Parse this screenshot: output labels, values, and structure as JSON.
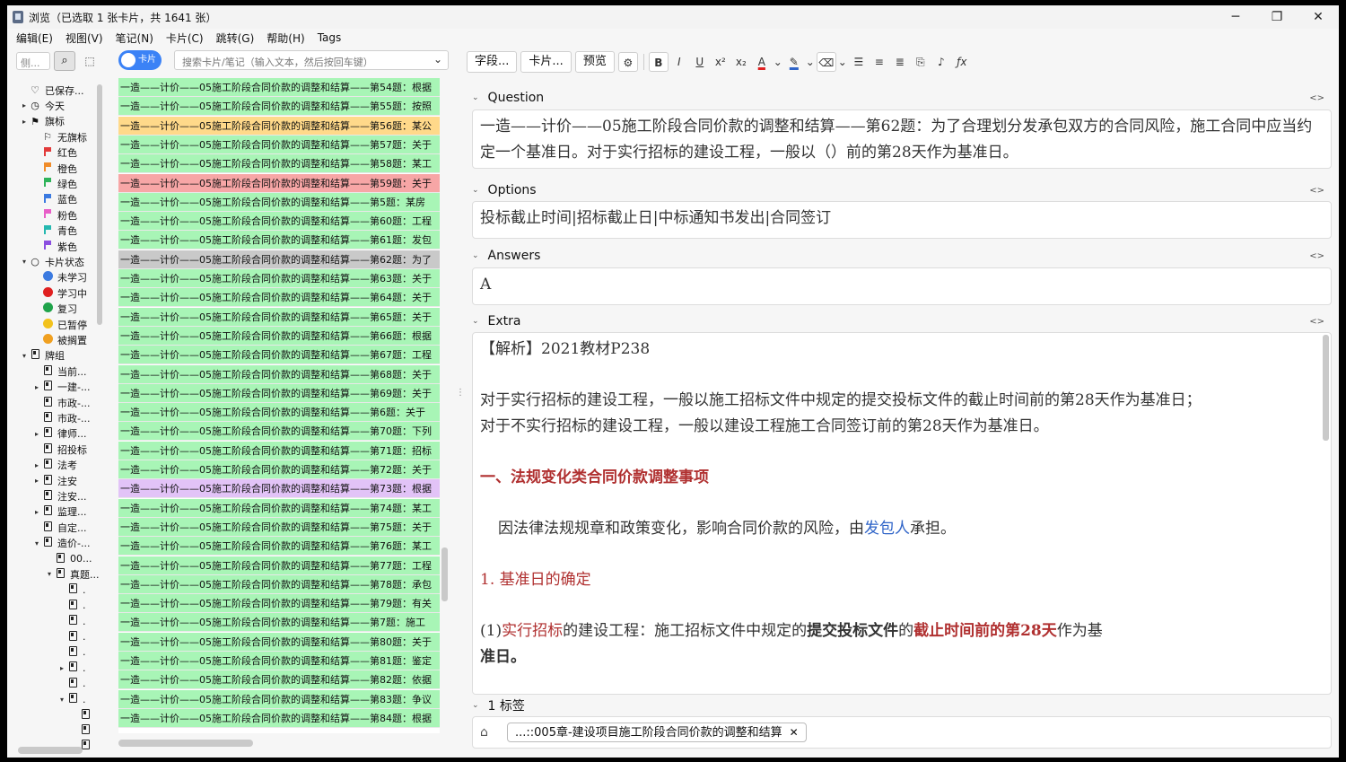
{
  "window": {
    "title": "浏览（已选取 1 张卡片，共 1641 张）",
    "minimize": "─",
    "maximize": "❐",
    "close": "✕"
  },
  "menu": [
    "编辑(E)",
    "视图(V)",
    "笔记(N)",
    "卡片(C)",
    "跳转(G)",
    "帮助(H)",
    "Tags"
  ],
  "sidebar": {
    "search_placeholder": "侧...",
    "items": [
      {
        "label": "已保存...",
        "icon": "heart-icon",
        "arrow": "",
        "indent": 1
      },
      {
        "label": "今天",
        "icon": "clock-icon",
        "arrow": "▸",
        "indent": 1
      },
      {
        "label": "旗标",
        "icon": "flag-icon",
        "arrow": "▸",
        "indent": 1
      },
      {
        "label": "无旗标",
        "icon": "no-flag-icon",
        "arrow": "",
        "indent": 2
      },
      {
        "label": "红色",
        "icon": "flag-red-icon",
        "color": "#e23b3b",
        "arrow": "",
        "indent": 2
      },
      {
        "label": "橙色",
        "icon": "flag-orange-icon",
        "color": "#f08c2a",
        "arrow": "",
        "indent": 2
      },
      {
        "label": "绿色",
        "icon": "flag-green-icon",
        "color": "#2fb35a",
        "arrow": "",
        "indent": 2
      },
      {
        "label": "蓝色",
        "icon": "flag-blue-icon",
        "color": "#3b7ae0",
        "arrow": "",
        "indent": 2
      },
      {
        "label": "粉色",
        "icon": "flag-pink-icon",
        "color": "#e85fc8",
        "arrow": "",
        "indent": 2
      },
      {
        "label": "青色",
        "icon": "flag-cyan-icon",
        "color": "#25b8b0",
        "arrow": "",
        "indent": 2
      },
      {
        "label": "紫色",
        "icon": "flag-purple-icon",
        "color": "#8b4fe0",
        "arrow": "",
        "indent": 2
      },
      {
        "label": "卡片状态",
        "icon": "circle-icon",
        "arrow": "▾",
        "indent": 1
      },
      {
        "label": "未学习",
        "icon": "dot-blue-icon",
        "color": "#3b7ae0",
        "arrow": "",
        "indent": 2
      },
      {
        "label": "学习中",
        "icon": "dot-red-icon",
        "color": "#e02020",
        "arrow": "",
        "indent": 2
      },
      {
        "label": "复习",
        "icon": "dot-green-icon",
        "color": "#1fa34a",
        "arrow": "",
        "indent": 2
      },
      {
        "label": "已暂停",
        "icon": "dot-yellow-icon",
        "color": "#f2c21c",
        "arrow": "",
        "indent": 2
      },
      {
        "label": "被搁置",
        "icon": "dot-orange-icon",
        "color": "#f0a020",
        "arrow": "",
        "indent": 2
      },
      {
        "label": "牌组",
        "icon": "deck-icon",
        "arrow": "▾",
        "indent": 1
      },
      {
        "label": "当前...",
        "icon": "deck-icon",
        "arrow": "",
        "indent": 2
      },
      {
        "label": "一建-...",
        "icon": "deck-icon",
        "arrow": "▸",
        "indent": 2
      },
      {
        "label": "市政-...",
        "icon": "deck-icon",
        "arrow": "",
        "indent": 2
      },
      {
        "label": "市政-...",
        "icon": "deck-icon",
        "arrow": "",
        "indent": 2
      },
      {
        "label": "律师...",
        "icon": "deck-icon",
        "arrow": "▸",
        "indent": 2
      },
      {
        "label": "招投标",
        "icon": "deck-icon",
        "arrow": "",
        "indent": 2
      },
      {
        "label": "法考",
        "icon": "deck-icon",
        "arrow": "▸",
        "indent": 2
      },
      {
        "label": "注安",
        "icon": "deck-icon",
        "arrow": "▸",
        "indent": 2
      },
      {
        "label": "注安...",
        "icon": "deck-icon",
        "arrow": "",
        "indent": 2
      },
      {
        "label": "监理...",
        "icon": "deck-icon",
        "arrow": "▸",
        "indent": 2
      },
      {
        "label": "自定...",
        "icon": "deck-icon",
        "arrow": "",
        "indent": 2
      },
      {
        "label": "造价-...",
        "icon": "deck-icon",
        "arrow": "▾",
        "indent": 2
      },
      {
        "label": "00...",
        "icon": "deck-icon",
        "arrow": "",
        "indent": 3
      },
      {
        "label": "真题...",
        "icon": "deck-icon",
        "arrow": "▾",
        "indent": 3
      },
      {
        "label": ".",
        "icon": "deck-icon",
        "arrow": "",
        "indent": 4
      },
      {
        "label": ".",
        "icon": "deck-icon",
        "arrow": "",
        "indent": 4
      },
      {
        "label": ".",
        "icon": "deck-icon",
        "arrow": "",
        "indent": 4
      },
      {
        "label": ".",
        "icon": "deck-icon",
        "arrow": "",
        "indent": 4
      },
      {
        "label": ".",
        "icon": "deck-icon",
        "arrow": "",
        "indent": 4
      },
      {
        "label": ".",
        "icon": "deck-icon",
        "arrow": "▸",
        "indent": 4
      },
      {
        "label": ".",
        "icon": "deck-icon",
        "arrow": "",
        "indent": 4
      },
      {
        "label": ".",
        "icon": "deck-icon",
        "arrow": "▾",
        "indent": 4
      },
      {
        "label": "",
        "icon": "deck-icon",
        "arrow": "",
        "indent": 5
      },
      {
        "label": "",
        "icon": "deck-icon",
        "arrow": "",
        "indent": 5
      },
      {
        "label": "",
        "icon": "deck-icon",
        "arrow": "",
        "indent": 5
      }
    ]
  },
  "browser": {
    "toggle_label": "卡片",
    "search_placeholder": "搜索卡片/笔记（输入文本，然后按回车键）",
    "rows": [
      {
        "text": "一造——计价——05施工阶段合同价款的调整和结算——第54题：根据",
        "color": "g"
      },
      {
        "text": "一造——计价——05施工阶段合同价款的调整和结算——第55题：按照",
        "color": "g"
      },
      {
        "text": "一造——计价——05施工阶段合同价款的调整和结算——第56题：某公",
        "color": "y"
      },
      {
        "text": "一造——计价——05施工阶段合同价款的调整和结算——第57题：关于",
        "color": "g"
      },
      {
        "text": "一造——计价——05施工阶段合同价款的调整和结算——第58题：某工",
        "color": "g"
      },
      {
        "text": "一造——计价——05施工阶段合同价款的调整和结算——第59题：关于",
        "color": "r"
      },
      {
        "text": "一造——计价——05施工阶段合同价款的调整和结算——第5题：某房",
        "color": "g"
      },
      {
        "text": "一造——计价——05施工阶段合同价款的调整和结算——第60题：工程",
        "color": "g"
      },
      {
        "text": "一造——计价——05施工阶段合同价款的调整和结算——第61题：发包",
        "color": "g"
      },
      {
        "text": "一造——计价——05施工阶段合同价款的调整和结算——第62题：为了",
        "color": "s"
      },
      {
        "text": "一造——计价——05施工阶段合同价款的调整和结算——第63题：关于",
        "color": "g"
      },
      {
        "text": "一造——计价——05施工阶段合同价款的调整和结算——第64题：关于",
        "color": "g"
      },
      {
        "text": "一造——计价——05施工阶段合同价款的调整和结算——第65题：关于",
        "color": "g"
      },
      {
        "text": "一造——计价——05施工阶段合同价款的调整和结算——第66题：根据",
        "color": "g"
      },
      {
        "text": "一造——计价——05施工阶段合同价款的调整和结算——第67题：工程",
        "color": "g"
      },
      {
        "text": "一造——计价——05施工阶段合同价款的调整和结算——第68题：关于",
        "color": "g"
      },
      {
        "text": "一造——计价——05施工阶段合同价款的调整和结算——第69题：关于",
        "color": "g"
      },
      {
        "text": "一造——计价——05施工阶段合同价款的调整和结算——第6题：关于",
        "color": "g"
      },
      {
        "text": "一造——计价——05施工阶段合同价款的调整和结算——第70题：下列",
        "color": "g"
      },
      {
        "text": "一造——计价——05施工阶段合同价款的调整和结算——第71题：招标",
        "color": "g"
      },
      {
        "text": "一造——计价——05施工阶段合同价款的调整和结算——第72题：关于",
        "color": "g"
      },
      {
        "text": "一造——计价——05施工阶段合同价款的调整和结算——第73题：根据",
        "color": "p"
      },
      {
        "text": "一造——计价——05施工阶段合同价款的调整和结算——第74题：某工",
        "color": "g"
      },
      {
        "text": "一造——计价——05施工阶段合同价款的调整和结算——第75题：关于",
        "color": "g"
      },
      {
        "text": "一造——计价——05施工阶段合同价款的调整和结算——第76题：某工",
        "color": "g"
      },
      {
        "text": "一造——计价——05施工阶段合同价款的调整和结算——第77题：工程",
        "color": "g"
      },
      {
        "text": "一造——计价——05施工阶段合同价款的调整和结算——第78题：承包",
        "color": "g"
      },
      {
        "text": "一造——计价——05施工阶段合同价款的调整和结算——第79题：有关",
        "color": "g"
      },
      {
        "text": "一造——计价——05施工阶段合同价款的调整和结算——第7题：施工",
        "color": "g"
      },
      {
        "text": "一造——计价——05施工阶段合同价款的调整和结算——第80题：关于",
        "color": "g"
      },
      {
        "text": "一造——计价——05施工阶段合同价款的调整和结算——第81题：鉴定",
        "color": "g"
      },
      {
        "text": "一造——计价——05施工阶段合同价款的调整和结算——第82题：依据",
        "color": "g"
      },
      {
        "text": "一造——计价——05施工阶段合同价款的调整和结算——第83题：争议",
        "color": "g"
      },
      {
        "text": "一造——计价——05施工阶段合同价款的调整和结算——第84题：根据",
        "color": "g"
      }
    ]
  },
  "toolbar": {
    "fields": "字段...",
    "cards": "卡片...",
    "preview": "预览"
  },
  "editor": {
    "question_label": "Question",
    "question": "一造——计价——05施工阶段合同价款的调整和结算——第62题：为了合理划分发承包双方的合同风险，施工合同中应当约定一个基准日。对于实行招标的建设工程，一般以（）前的第28天作为基准日。",
    "options_label": "Options",
    "options": "投标截止时间|招标截止日|中标通知书发出|合同签订",
    "answers_label": "Answers",
    "answers": "A",
    "extra_label": "Extra",
    "extra": {
      "p1": "【解析】2021教材P238",
      "p2": "对于实行招标的建设工程，一般以施工招标文件中规定的提交投标文件的截止时间前的第28天作为基准日；",
      "p3": "对于不实行招标的建设工程，一般以建设工程施工合同签订前的第28天作为基准日。",
      "h1": "一、法规变化类合同价款调整事项",
      "p4a": "因法律法规规章和政策变化，影响合同价款的风险，由",
      "p4b": "发包人",
      "p4c": "承担。",
      "h2": "1. 基准日的确定",
      "p5a": "(1)",
      "p5b": "实行招标",
      "p5c": "的建设工程：施工招标文件中规定的",
      "p5d": "提交投标文件",
      "p5e": "的",
      "p5f": "截止时间前的第28天",
      "p5g": "作为基",
      "p5h": "准日。"
    },
    "tags_label": "1 标签",
    "tag": "...::005章-建设项目施工阶段合同价款的调整和结算",
    "html_toggle": "<>"
  }
}
